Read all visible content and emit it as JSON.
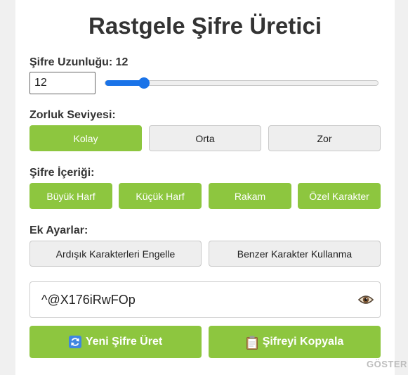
{
  "title": "Rastgele Şifre Üretici",
  "length": {
    "label": "Şifre Uzunluğu: 12",
    "value": "12",
    "slider_fraction": 0.14
  },
  "difficulty": {
    "label": "Zorluk Seviyesi:",
    "options": [
      "Kolay",
      "Orta",
      "Zor"
    ],
    "selected": "Kolay"
  },
  "content": {
    "label": "Şifre İçeriği:",
    "options": [
      "Büyük Harf",
      "Küçük Harf",
      "Rakam",
      "Özel Karakter"
    ]
  },
  "extra": {
    "label": "Ek Ayarlar:",
    "options": [
      "Ardışık Karakterleri Engelle",
      "Benzer Karakter Kullanma"
    ]
  },
  "password": {
    "value": "^@X176iRwFOp",
    "toggle_icon": "eye-icon"
  },
  "actions": {
    "generate": "Yeni Şifre Üret",
    "generate_icon": "refresh-icon",
    "copy": "Şifreyi Kopyala",
    "copy_icon": "clipboard-icon"
  },
  "watermark": "GÖSTER",
  "colors": {
    "accent_green": "#8dc63f",
    "slider_blue": "#1a73e8",
    "title": "#333333"
  }
}
